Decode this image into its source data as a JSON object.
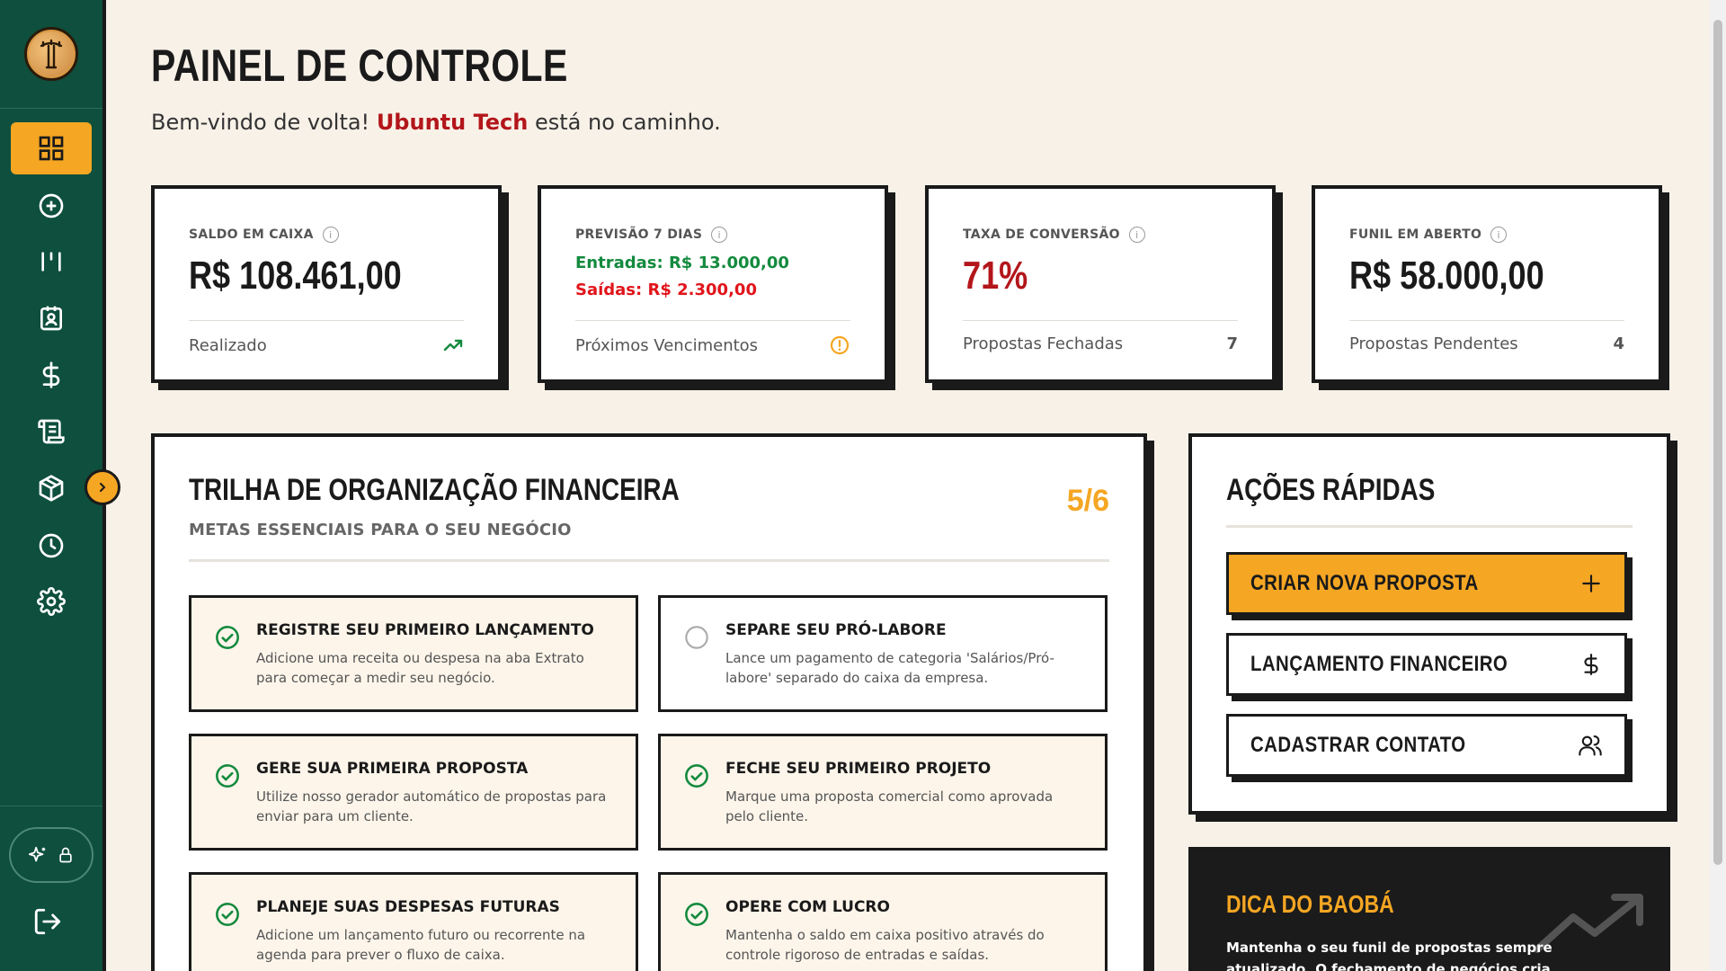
{
  "header": {
    "title": "PAINEL DE CONTROLE",
    "welcome_prefix": "Bem-vindo de volta! ",
    "company": "Ubuntu Tech",
    "welcome_suffix": " está no caminho."
  },
  "sidebar": {
    "items": [
      {
        "icon": "dashboard-grid-icon",
        "active": true
      },
      {
        "icon": "plus-circle-icon"
      },
      {
        "icon": "kanban-icon"
      },
      {
        "icon": "contact-card-icon"
      },
      {
        "icon": "dollar-icon"
      },
      {
        "icon": "scroll-icon"
      },
      {
        "icon": "package-icon"
      },
      {
        "icon": "clock-icon"
      },
      {
        "icon": "gear-icon"
      }
    ],
    "ai_toggle": {
      "icons": [
        "sparkles-icon",
        "lock-icon"
      ]
    },
    "logout_icon": "logout-icon"
  },
  "stats": {
    "balance": {
      "label": "SALDO EM CAIXA",
      "value": "R$ 108.461,00",
      "footer": "Realizado"
    },
    "forecast": {
      "label": "PREVISÃO 7 DIAS",
      "inflow": "Entradas: R$ 13.000,00",
      "outflow": "Saídas: R$ 2.300,00",
      "footer": "Próximos Vencimentos"
    },
    "conversion": {
      "label": "TAXA DE CONVERSÃO",
      "value": "71%",
      "footer": "Propostas Fechadas",
      "count": "7"
    },
    "funnel": {
      "label": "FUNIL EM ABERTO",
      "value": "R$ 58.000,00",
      "footer": "Propostas Pendentes",
      "count": "4"
    }
  },
  "trail": {
    "title": "TRILHA DE ORGANIZAÇÃO FINANCEIRA",
    "subtitle": "METAS ESSENCIAIS PARA O SEU NEGÓCIO",
    "progress": "5/6",
    "tasks": [
      {
        "title": "REGISTRE SEU PRIMEIRO LANÇAMENTO",
        "desc": "Adicione uma receita ou despesa na aba Extrato para começar a medir seu negócio.",
        "done": true
      },
      {
        "title": "SEPARE SEU PRÓ-LABORE",
        "desc": "Lance um pagamento de categoria 'Salários/Pró-labore' separado do caixa da empresa.",
        "done": false
      },
      {
        "title": "GERE SUA PRIMEIRA PROPOSTA",
        "desc": "Utilize nosso gerador automático de propostas para enviar para um cliente.",
        "done": true
      },
      {
        "title": "FECHE SEU PRIMEIRO PROJETO",
        "desc": "Marque uma proposta comercial como aprovada pelo cliente.",
        "done": true
      },
      {
        "title": "PLANEJE SUAS DESPESAS FUTURAS",
        "desc": "Adicione um lançamento futuro ou recorrente na agenda para prever o fluxo de caixa.",
        "done": true
      },
      {
        "title": "OPERE COM LUCRO",
        "desc": "Mantenha o saldo em caixa positivo através do controle rigoroso de entradas e saídas.",
        "done": true
      }
    ]
  },
  "quick_actions": {
    "title": "AÇÕES RÁPIDAS",
    "buttons": [
      {
        "label": "CRIAR NOVA PROPOSTA",
        "icon": "plus-icon"
      },
      {
        "label": "LANÇAMENTO FINANCEIRO",
        "icon": "dollar-icon"
      },
      {
        "label": "CADASTRAR CONTATO",
        "icon": "users-icon"
      }
    ]
  },
  "tip": {
    "title": "DICA DO BAOBÁ",
    "text": "Mantenha o seu funil de propostas sempre atualizado. O fechamento de negócios cria automaticamente"
  },
  "colors": {
    "sidebar": "#0e4f3d",
    "accent": "#f5a623",
    "brand_red": "#b3161b",
    "green": "#138a3e",
    "background": "#f8f1e8"
  }
}
